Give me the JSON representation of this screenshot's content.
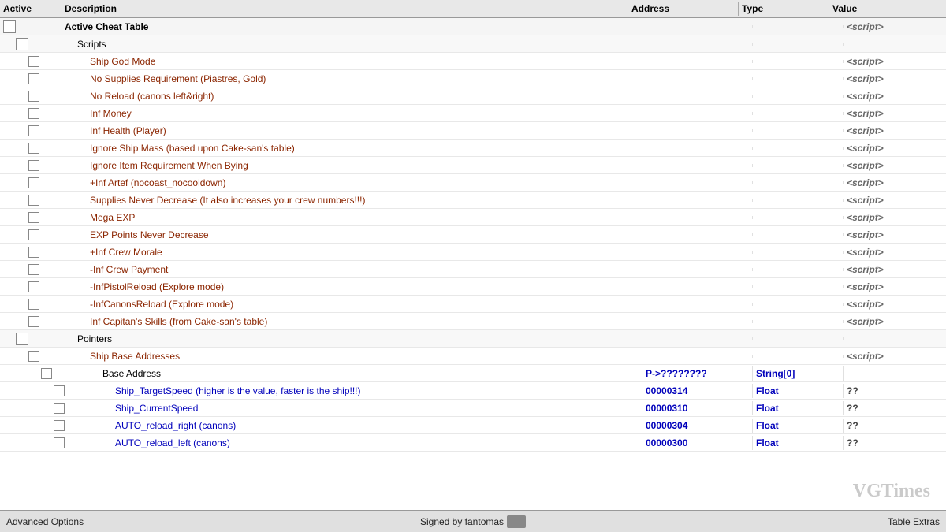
{
  "header": {
    "col_active": "Active",
    "col_description": "Description",
    "col_address": "Address",
    "col_type": "Type",
    "col_value": "Value"
  },
  "rows": [
    {
      "id": "root",
      "level": 0,
      "checkbox": true,
      "checkbox_size": "large",
      "label": "Active Cheat Table",
      "address": "",
      "type": "",
      "value": "<script>",
      "color": "black",
      "bold": true
    },
    {
      "id": "scripts",
      "level": 1,
      "checkbox": true,
      "checkbox_size": "large",
      "label": "Scripts",
      "address": "",
      "type": "",
      "value": "",
      "color": "black",
      "bold": false
    },
    {
      "id": "ship-god-mode",
      "level": 2,
      "checkbox": true,
      "checkbox_size": "small",
      "label": "Ship God Mode",
      "address": "",
      "type": "",
      "value": "<script>",
      "color": "dark-red"
    },
    {
      "id": "no-supplies",
      "level": 2,
      "checkbox": true,
      "checkbox_size": "small",
      "label": "No Supplies Requirement (Piastres, Gold)",
      "address": "",
      "type": "",
      "value": "<script>",
      "color": "dark-red"
    },
    {
      "id": "no-reload",
      "level": 2,
      "checkbox": true,
      "checkbox_size": "small",
      "label": "No Reload (canons left&right)",
      "address": "",
      "type": "",
      "value": "<script>",
      "color": "dark-red"
    },
    {
      "id": "inf-money",
      "level": 2,
      "checkbox": true,
      "checkbox_size": "small",
      "label": "Inf Money",
      "address": "",
      "type": "",
      "value": "<script>",
      "color": "dark-red"
    },
    {
      "id": "inf-health",
      "level": 2,
      "checkbox": true,
      "checkbox_size": "small",
      "label": "Inf Health (Player)",
      "address": "",
      "type": "",
      "value": "<script>",
      "color": "dark-red"
    },
    {
      "id": "ignore-ship-mass",
      "level": 2,
      "checkbox": true,
      "checkbox_size": "small",
      "label": "Ignore Ship Mass  (based upon Cake-san's table)",
      "address": "",
      "type": "",
      "value": "<script>",
      "color": "dark-red"
    },
    {
      "id": "ignore-item-req",
      "level": 2,
      "checkbox": true,
      "checkbox_size": "small",
      "label": "Ignore Item Requirement When Bying",
      "address": "",
      "type": "",
      "value": "<script>",
      "color": "dark-red"
    },
    {
      "id": "inf-artef",
      "level": 2,
      "checkbox": true,
      "checkbox_size": "small",
      "label": "+Inf Artef (nocoast_nocooldown)",
      "address": "",
      "type": "",
      "value": "<script>",
      "color": "dark-red"
    },
    {
      "id": "supplies-never",
      "level": 2,
      "checkbox": true,
      "checkbox_size": "small",
      "label": "Supplies Never Decrease (It also increases your crew numbers!!!)",
      "address": "",
      "type": "",
      "value": "<script>",
      "color": "dark-red"
    },
    {
      "id": "mega-exp",
      "level": 2,
      "checkbox": true,
      "checkbox_size": "small",
      "label": "Mega EXP",
      "address": "",
      "type": "",
      "value": "<script>",
      "color": "dark-red"
    },
    {
      "id": "exp-never",
      "level": 2,
      "checkbox": true,
      "checkbox_size": "small",
      "label": "EXP Points Never Decrease",
      "address": "",
      "type": "",
      "value": "<script>",
      "color": "dark-red"
    },
    {
      "id": "inf-crew-morale",
      "level": 2,
      "checkbox": true,
      "checkbox_size": "small",
      "label": "+Inf Crew Morale",
      "address": "",
      "type": "",
      "value": "<script>",
      "color": "dark-red"
    },
    {
      "id": "inf-crew-payment",
      "level": 2,
      "checkbox": true,
      "checkbox_size": "small",
      "label": "-Inf Crew Payment",
      "address": "",
      "type": "",
      "value": "<script>",
      "color": "dark-red"
    },
    {
      "id": "inf-pistol-reload",
      "level": 2,
      "checkbox": true,
      "checkbox_size": "small",
      "label": "-InfPistolReload (Explore mode)",
      "address": "",
      "type": "",
      "value": "<script>",
      "color": "dark-red"
    },
    {
      "id": "inf-canons-reload",
      "level": 2,
      "checkbox": true,
      "checkbox_size": "small",
      "label": "-InfCanonsReload (Explore mode)",
      "address": "",
      "type": "",
      "value": "<script>",
      "color": "dark-red"
    },
    {
      "id": "inf-capitan",
      "level": 2,
      "checkbox": true,
      "checkbox_size": "small",
      "label": "Inf Capitan's Skills (from Cake-san's table)",
      "address": "",
      "type": "",
      "value": "<script>",
      "color": "dark-red"
    },
    {
      "id": "pointers",
      "level": 1,
      "checkbox": true,
      "checkbox_size": "large",
      "label": "Pointers",
      "address": "",
      "type": "",
      "value": "",
      "color": "black"
    },
    {
      "id": "ship-base-addresses",
      "level": 2,
      "checkbox": true,
      "checkbox_size": "small",
      "label": "Ship Base Addresses",
      "address": "",
      "type": "",
      "value": "<script>",
      "color": "dark-red"
    },
    {
      "id": "base-address",
      "level": 3,
      "checkbox": true,
      "checkbox_size": "small",
      "label": "Base Address",
      "address": "P->????????",
      "type": "String[0]",
      "value": "",
      "color": "black"
    },
    {
      "id": "ship-target-speed",
      "level": 4,
      "checkbox": true,
      "checkbox_size": "small",
      "label": "Ship_TargetSpeed (higher is the value, faster is the ship!!!)",
      "address": "00000314",
      "type": "Float",
      "value": "??",
      "color": "blue"
    },
    {
      "id": "ship-current-speed",
      "level": 4,
      "checkbox": true,
      "checkbox_size": "small",
      "label": "Ship_CurrentSpeed",
      "address": "00000310",
      "type": "Float",
      "value": "??",
      "color": "blue"
    },
    {
      "id": "auto-reload-right",
      "level": 4,
      "checkbox": true,
      "checkbox_size": "small",
      "label": "AUTO_reload_right (canons)",
      "address": "00000304",
      "type": "Float",
      "value": "??",
      "color": "blue"
    },
    {
      "id": "auto-reload-left",
      "level": 4,
      "checkbox": true,
      "checkbox_size": "small",
      "label": "AUTO_reload_left (canons)",
      "address": "00000300",
      "type": "Float",
      "value": "??",
      "color": "blue"
    }
  ],
  "footer": {
    "left": "Advanced Options",
    "center": "Signed by fantomas",
    "right": "Table Extras"
  },
  "watermark": "VGTimes"
}
